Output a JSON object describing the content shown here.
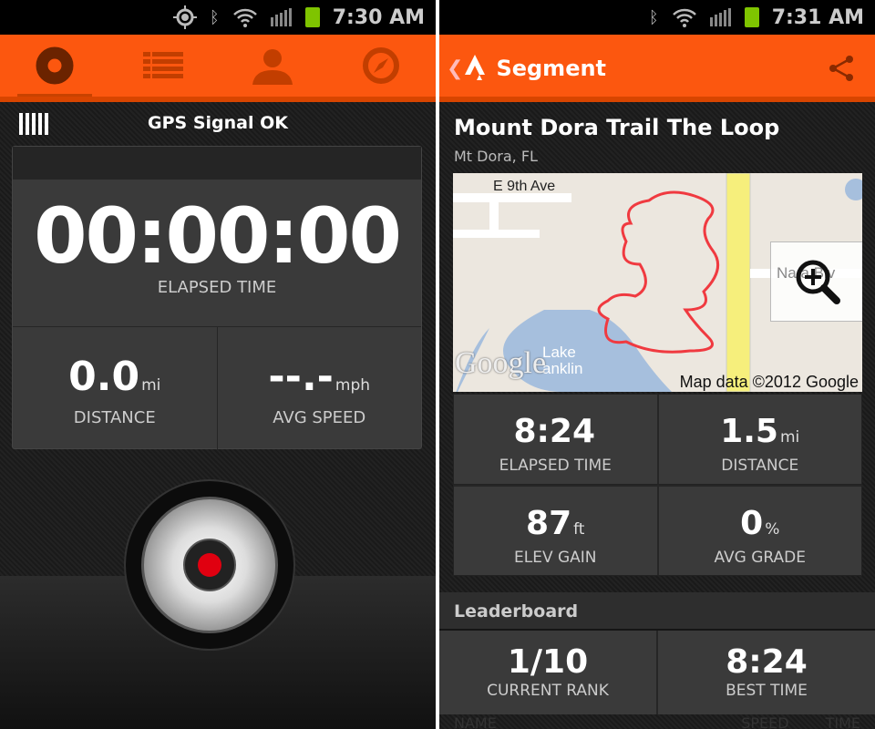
{
  "left": {
    "status": {
      "time": "7:30 AM",
      "icons": [
        "gps-icon",
        "bluetooth-icon",
        "wifi-icon",
        "signal-icon",
        "battery-icon"
      ]
    },
    "tabs": [
      {
        "icon": "record-icon",
        "active": true
      },
      {
        "icon": "list-icon"
      },
      {
        "icon": "profile-icon"
      },
      {
        "icon": "explore-compass-icon"
      }
    ],
    "gps_status": "GPS Signal OK",
    "elapsed": {
      "value": "00:00:00",
      "label": "ELAPSED TIME"
    },
    "distance": {
      "value": "0.0",
      "unit": "mi",
      "label": "DISTANCE"
    },
    "avg_speed": {
      "value": "--.-",
      "unit": "mph",
      "label": "AVG SPEED"
    },
    "record_button": "record-icon"
  },
  "right": {
    "status": {
      "time": "7:31 AM"
    },
    "header": {
      "title": "Segment",
      "share_icon": "share-icon"
    },
    "segment": {
      "name": "Mount Dora Trail The Loop",
      "location": "Mt Dora, FL"
    },
    "map": {
      "street": "E 9th Ave",
      "street2": "Na  a Blv",
      "lake1": "Lake",
      "lake2": "anklin",
      "logo": "Google",
      "attribution": "Map data ©2012 Google"
    },
    "stats": [
      {
        "value": "8:24",
        "unit": "",
        "label": "ELAPSED TIME"
      },
      {
        "value": "1.5",
        "unit": "mi",
        "label": "DISTANCE"
      },
      {
        "value": "87",
        "unit": "ft",
        "label": "ELEV GAIN"
      },
      {
        "value": "0",
        "unit": "%",
        "label": "AVG GRADE"
      }
    ],
    "leaderboard": {
      "title": "Leaderboard",
      "rank": {
        "value": "1/10",
        "label": "CURRENT RANK"
      },
      "best": {
        "value": "8:24",
        "label": "BEST TIME"
      },
      "columns": [
        "NAME",
        "SPEED",
        "TIME"
      ]
    }
  },
  "colors": {
    "brand_orange": "#fc570f",
    "record_red": "#e00010",
    "trail_red": "#f03a40"
  }
}
